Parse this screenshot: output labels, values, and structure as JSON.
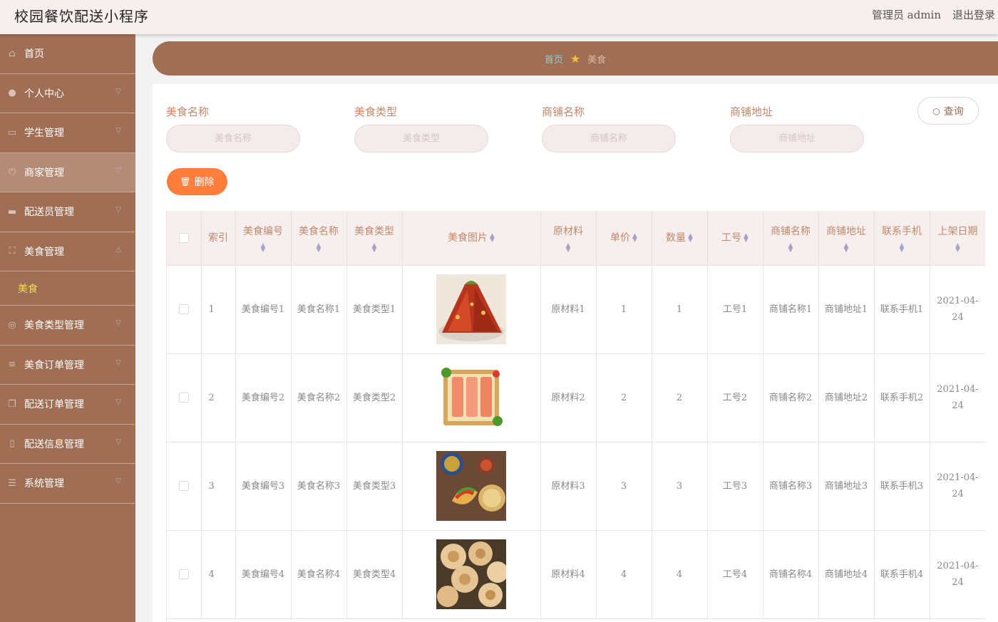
{
  "header": {
    "title": "校园餐饮配送小程序",
    "admin": "管理员 admin",
    "logout": "退出登录"
  },
  "sidebar": {
    "items": [
      {
        "label": "首页",
        "icon": "home-icon",
        "glyph": "⌂",
        "chev": ""
      },
      {
        "label": "个人中心",
        "icon": "user-icon",
        "glyph": "●",
        "chev": "▽"
      },
      {
        "label": "学生管理",
        "icon": "desktop-icon",
        "glyph": "▭",
        "chev": "▽"
      },
      {
        "label": "商家管理",
        "icon": "power-icon",
        "glyph": "⏻",
        "chev": "▽",
        "active": true
      },
      {
        "label": "配送员管理",
        "icon": "monitor-icon",
        "glyph": "▬",
        "chev": "▽"
      },
      {
        "label": "美食管理",
        "icon": "frame-icon",
        "glyph": "⛶",
        "chev": "△"
      },
      {
        "label": "美食",
        "sub": true
      },
      {
        "label": "美食类型管理",
        "icon": "globe-icon",
        "glyph": "◎",
        "chev": "▽"
      },
      {
        "label": "美食订单管理",
        "icon": "list-icon",
        "glyph": "≡",
        "chev": "▽"
      },
      {
        "label": "配送订单管理",
        "icon": "copy-icon",
        "glyph": "❐",
        "chev": "▽"
      },
      {
        "label": "配送信息管理",
        "icon": "mobile-icon",
        "glyph": "▯",
        "chev": "▽"
      },
      {
        "label": "系统管理",
        "icon": "sliders-icon",
        "glyph": "☰",
        "chev": "▽"
      }
    ]
  },
  "breadcrumb": {
    "home": "首页",
    "current": "美食"
  },
  "filters": [
    {
      "label": "美食名称",
      "placeholder": "美食名称"
    },
    {
      "label": "美食类型",
      "placeholder": "美食类型"
    },
    {
      "label": "商铺名称",
      "placeholder": "商铺名称"
    },
    {
      "label": "商铺地址",
      "placeholder": "商铺地址"
    }
  ],
  "buttons": {
    "query": "查询",
    "delete": "删除"
  },
  "table": {
    "columns": [
      "索引",
      "美食编号",
      "美食名称",
      "美食类型",
      "美食图片",
      "原材料",
      "单价",
      "数量",
      "工号",
      "商铺名称",
      "商铺地址",
      "联系手机",
      "上架日期"
    ],
    "rows": [
      {
        "index": "1",
        "code": "美食编号1",
        "name": "美食名称1",
        "type": "美食类型1",
        "image": "food-mound",
        "material": "原材料1",
        "price": "1",
        "qty": "1",
        "workno": "工号1",
        "shop": "商铺名称1",
        "addr": "商铺地址1",
        "phone": "联系手机1",
        "date": "2021-04-24"
      },
      {
        "index": "2",
        "code": "美食编号2",
        "name": "美食名称2",
        "type": "美食类型2",
        "image": "food-platter",
        "material": "原材料2",
        "price": "2",
        "qty": "2",
        "workno": "工号2",
        "shop": "商铺名称2",
        "addr": "商铺地址2",
        "phone": "联系手机2",
        "date": "2021-04-24"
      },
      {
        "index": "3",
        "code": "美食编号3",
        "name": "美食名称3",
        "type": "美食类型3",
        "image": "food-tacos",
        "material": "原材料3",
        "price": "3",
        "qty": "3",
        "workno": "工号3",
        "shop": "商铺名称3",
        "addr": "商铺地址3",
        "phone": "联系手机3",
        "date": "2021-04-24"
      },
      {
        "index": "4",
        "code": "美食编号4",
        "name": "美食名称4",
        "type": "美食类型4",
        "image": "food-flatbread",
        "material": "原材料4",
        "price": "4",
        "qty": "4",
        "workno": "工号4",
        "shop": "商铺名称4",
        "addr": "商铺地址4",
        "phone": "联系手机4",
        "date": "2021-04-24"
      }
    ]
  },
  "colors": {
    "sidebar": "#9f6e55",
    "accent_delete": "#ff7e3b",
    "label": "#c0886c",
    "active_sub": "#f5d76e"
  }
}
